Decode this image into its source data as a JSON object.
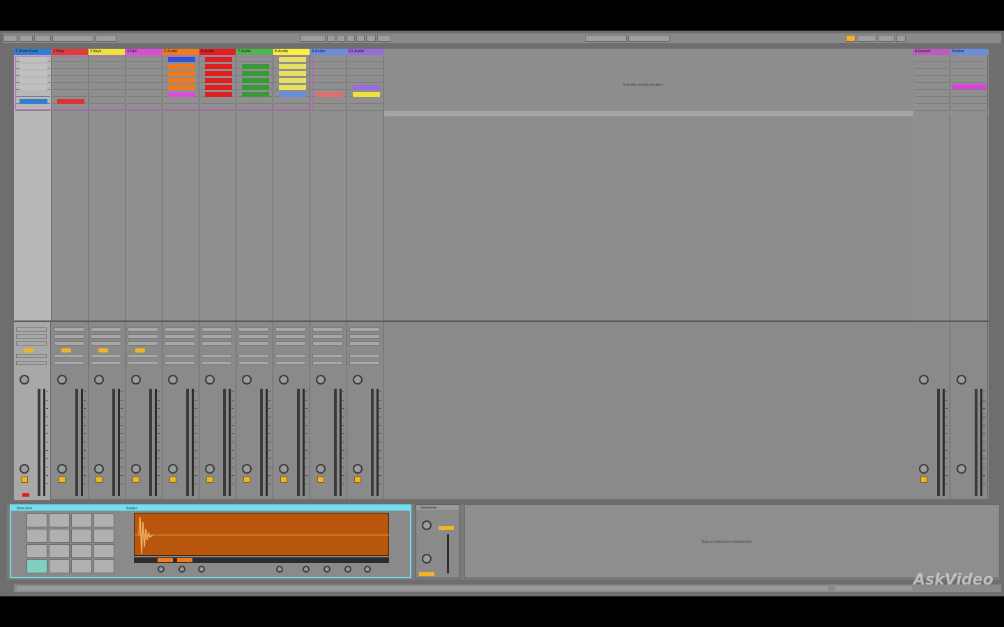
{
  "tracks": [
    {
      "name": "1 Drum Rack",
      "color": "#2d7fd6"
    },
    {
      "name": "2 Bass",
      "color": "#e03a3a"
    },
    {
      "name": "3 Keys",
      "color": "#f0e040"
    },
    {
      "name": "4 Pad",
      "color": "#d64fd6"
    },
    {
      "name": "5 Audio",
      "color": "#f07a20"
    },
    {
      "name": "6 Audio",
      "color": "#e02020"
    },
    {
      "name": "7 Audio",
      "color": "#4cb84c"
    },
    {
      "name": "8 Audio",
      "color": "#f8f040"
    },
    {
      "name": "9 Audio",
      "color": "#6a8de0"
    },
    {
      "name": "10 Audio",
      "color": "#9a6ae0"
    }
  ],
  "returns": [
    {
      "name": "A Reverb",
      "color": "#c05ac0"
    }
  ],
  "master": {
    "name": "Master",
    "color": "#6a8de0"
  },
  "drop_text": "Drop Files and Devices Here",
  "detail": {
    "rack_title": "Drum Rack",
    "sampler_title": "Simpler",
    "compressor_title": "Compressor",
    "drop_text": "Drop an Instrument or Sample Here"
  },
  "status": "",
  "watermark": "AskVideo",
  "colors": {
    "accent": "#6fe0f0",
    "waveform_bg": "#b8560e",
    "track_num": "#f0b429"
  }
}
